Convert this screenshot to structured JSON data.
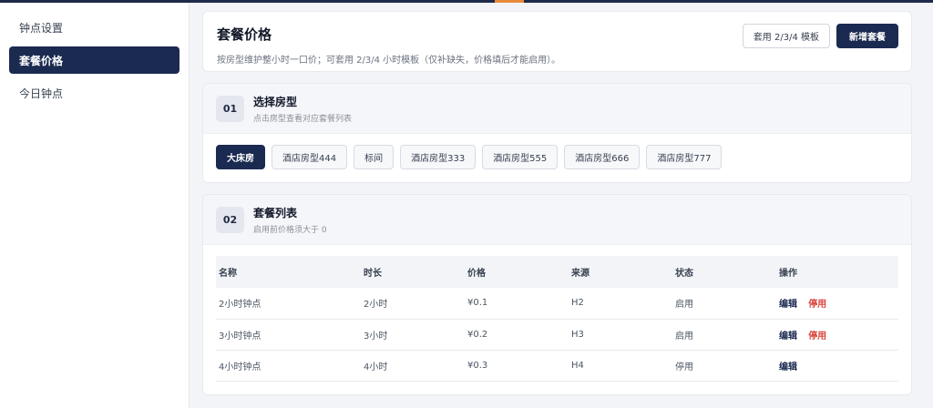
{
  "sidebar": {
    "items": [
      {
        "label": "钟点设置"
      },
      {
        "label": "套餐价格"
      },
      {
        "label": "今日钟点"
      }
    ]
  },
  "header": {
    "title": "套餐价格",
    "description": "按房型维护整小时一口价；可套用 2/3/4 小时模板（仅补缺失，价格填后才能启用）。",
    "apply_template_label": "套用 2/3/4 模板",
    "add_package_label": "新增套餐"
  },
  "room_section": {
    "number": "01",
    "title": "选择房型",
    "subtitle": "点击房型查看对应套餐列表",
    "rooms": [
      "大床房",
      "酒店房型444",
      "标间",
      "酒店房型333",
      "酒店房型555",
      "酒店房型666",
      "酒店房型777"
    ],
    "selected": "大床房"
  },
  "package_section": {
    "number": "02",
    "title": "套餐列表",
    "subtitle": "启用前价格须大于 0",
    "columns": [
      "名称",
      "时长",
      "价格",
      "来源",
      "状态",
      "操作"
    ],
    "rows": [
      {
        "name": "2小时钟点",
        "duration": "2小时",
        "price": "¥0.1",
        "source": "H2",
        "status": "启用",
        "edit": "编辑",
        "toggle": "停用"
      },
      {
        "name": "3小时钟点",
        "duration": "3小时",
        "price": "¥0.2",
        "source": "H3",
        "status": "启用",
        "edit": "编辑",
        "toggle": "停用"
      },
      {
        "name": "4小时钟点",
        "duration": "4小时",
        "price": "¥0.3",
        "source": "H4",
        "status": "停用",
        "edit": "编辑",
        "toggle": ""
      }
    ]
  },
  "colors": {
    "primary": "#1b2a50",
    "accent": "#e88a3a",
    "danger": "#d9423c"
  }
}
